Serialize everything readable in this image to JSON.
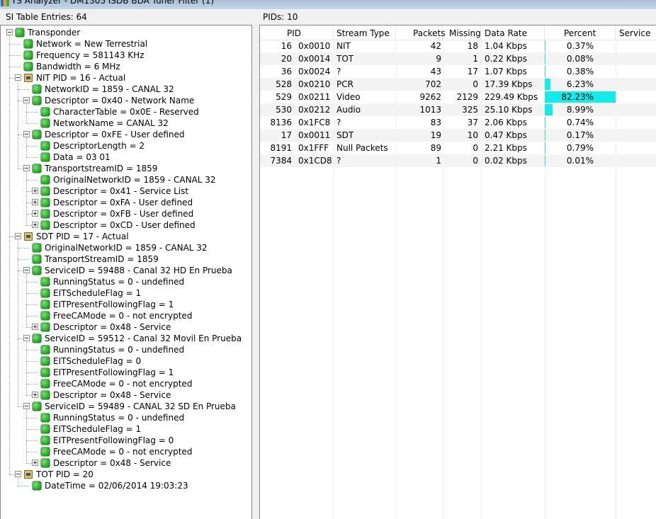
{
  "window": {
    "title": "TS Analyzer - DM1305 ISDB BDA Tuner Filter (1)"
  },
  "left_panel": {
    "header": "SI Table Entries: 64"
  },
  "right_panel": {
    "header": "PIDs: 10"
  },
  "tree": [
    {
      "label": "Transponder",
      "depth": 0,
      "expander": "minus",
      "icon": "green"
    },
    {
      "label": "Network = New Terrestrial",
      "depth": 1,
      "expander": "",
      "icon": "green"
    },
    {
      "label": "Frequency = 581143 KHz",
      "depth": 1,
      "expander": "",
      "icon": "green"
    },
    {
      "label": "Bandwidth = 6 MHz",
      "depth": 1,
      "expander": "",
      "icon": "green"
    },
    {
      "label": "NIT PID = 16 - Actual",
      "depth": 1,
      "expander": "minus",
      "icon": "table"
    },
    {
      "label": "NetworkID = 1859 - CANAL 32",
      "depth": 2,
      "expander": "",
      "icon": "green"
    },
    {
      "label": "Descriptor = 0x40 - Network Name",
      "depth": 2,
      "expander": "minus",
      "icon": "green"
    },
    {
      "label": "CharacterTable = 0x0E - Reserved",
      "depth": 3,
      "expander": "",
      "icon": "green"
    },
    {
      "label": "NetworkName = CANAL 32",
      "depth": 3,
      "expander": "",
      "icon": "green"
    },
    {
      "label": "Descriptor = 0xFE - User defined",
      "depth": 2,
      "expander": "minus",
      "icon": "green"
    },
    {
      "label": "DescriptorLength = 2",
      "depth": 3,
      "expander": "",
      "icon": "green"
    },
    {
      "label": "Data = 03 01",
      "depth": 3,
      "expander": "",
      "icon": "green"
    },
    {
      "label": "TransportstreamID = 1859",
      "depth": 2,
      "expander": "minus",
      "icon": "green"
    },
    {
      "label": "OriginalNetworkID = 1859 - CANAL 32",
      "depth": 3,
      "expander": "",
      "icon": "green"
    },
    {
      "label": "Descriptor = 0x41 - Service List",
      "depth": 3,
      "expander": "plus",
      "icon": "green"
    },
    {
      "label": "Descriptor = 0xFA - User defined",
      "depth": 3,
      "expander": "plus",
      "icon": "green"
    },
    {
      "label": "Descriptor = 0xFB - User defined",
      "depth": 3,
      "expander": "plus",
      "icon": "green"
    },
    {
      "label": "Descriptor = 0xCD - User defined",
      "depth": 3,
      "expander": "plus",
      "icon": "green"
    },
    {
      "label": "SDT PID = 17 - Actual",
      "depth": 1,
      "expander": "minus",
      "icon": "table"
    },
    {
      "label": "OriginalNetworkID = 1859 - CANAL 32",
      "depth": 2,
      "expander": "",
      "icon": "green"
    },
    {
      "label": "TransportStreamID = 1859",
      "depth": 2,
      "expander": "",
      "icon": "green"
    },
    {
      "label": "ServiceID = 59488 - Canal 32 HD En Prueba",
      "depth": 2,
      "expander": "minus",
      "icon": "green"
    },
    {
      "label": "RunningStatus = 0 - undefined",
      "depth": 3,
      "expander": "",
      "icon": "green"
    },
    {
      "label": "EITScheduleFlag = 1",
      "depth": 3,
      "expander": "",
      "icon": "green"
    },
    {
      "label": "EITPresentFollowingFlag = 1",
      "depth": 3,
      "expander": "",
      "icon": "green"
    },
    {
      "label": "FreeCAMode = 0 - not encrypted",
      "depth": 3,
      "expander": "",
      "icon": "green"
    },
    {
      "label": "Descriptor = 0x48 - Service",
      "depth": 3,
      "expander": "plus",
      "icon": "green"
    },
    {
      "label": "ServiceID = 59512 - Canal 32 Movil En Prueba",
      "depth": 2,
      "expander": "minus",
      "icon": "green"
    },
    {
      "label": "RunningStatus = 0 - undefined",
      "depth": 3,
      "expander": "",
      "icon": "green"
    },
    {
      "label": "EITScheduleFlag = 0",
      "depth": 3,
      "expander": "",
      "icon": "green"
    },
    {
      "label": "EITPresentFollowingFlag = 1",
      "depth": 3,
      "expander": "",
      "icon": "green"
    },
    {
      "label": "FreeCAMode = 0 - not encrypted",
      "depth": 3,
      "expander": "",
      "icon": "green"
    },
    {
      "label": "Descriptor = 0x48 - Service",
      "depth": 3,
      "expander": "plus",
      "icon": "green"
    },
    {
      "label": "ServiceID = 59489 - CANAL 32 SD  En Prueba",
      "depth": 2,
      "expander": "minus",
      "icon": "green"
    },
    {
      "label": "RunningStatus = 0 - undefined",
      "depth": 3,
      "expander": "",
      "icon": "green"
    },
    {
      "label": "EITScheduleFlag = 1",
      "depth": 3,
      "expander": "",
      "icon": "green"
    },
    {
      "label": "EITPresentFollowingFlag = 0",
      "depth": 3,
      "expander": "",
      "icon": "green"
    },
    {
      "label": "FreeCAMode = 0 - not encrypted",
      "depth": 3,
      "expander": "",
      "icon": "green"
    },
    {
      "label": "Descriptor = 0x48 - Service",
      "depth": 3,
      "expander": "plus",
      "icon": "green"
    },
    {
      "label": "TOT PID = 20",
      "depth": 1,
      "expander": "minus",
      "icon": "table"
    },
    {
      "label": "DateTime = 02/06/2014 19:03:23",
      "depth": 2,
      "expander": "",
      "icon": "green"
    }
  ],
  "pid_table": {
    "columns": [
      "PID",
      "Stream Type",
      "Packets",
      "Missing",
      "Data Rate",
      "Percent",
      "Service"
    ],
    "rows": [
      {
        "pid_dec": "16",
        "pid_hex": "0x0010",
        "stream_type": "NIT",
        "packets": "42",
        "missing": "18",
        "data_rate": "1.04 Kbps",
        "percent": "0.37%",
        "percent_value": 0.37,
        "service": ""
      },
      {
        "pid_dec": "20",
        "pid_hex": "0x0014",
        "stream_type": "TOT",
        "packets": "9",
        "missing": "1",
        "data_rate": "0.22 Kbps",
        "percent": "0.08%",
        "percent_value": 0.08,
        "service": ""
      },
      {
        "pid_dec": "36",
        "pid_hex": "0x0024",
        "stream_type": "?",
        "packets": "43",
        "missing": "17",
        "data_rate": "1.07 Kbps",
        "percent": "0.38%",
        "percent_value": 0.38,
        "service": ""
      },
      {
        "pid_dec": "528",
        "pid_hex": "0x0210",
        "stream_type": "PCR",
        "packets": "702",
        "missing": "0",
        "data_rate": "17.39 Kbps",
        "percent": "6.23%",
        "percent_value": 6.23,
        "service": ""
      },
      {
        "pid_dec": "529",
        "pid_hex": "0x0211",
        "stream_type": "Video",
        "packets": "9262",
        "missing": "2129",
        "data_rate": "229.49 Kbps",
        "percent": "82.23%",
        "percent_value": 82.23,
        "service": ""
      },
      {
        "pid_dec": "530",
        "pid_hex": "0x0212",
        "stream_type": "Audio",
        "packets": "1013",
        "missing": "325",
        "data_rate": "25.10 Kbps",
        "percent": "8.99%",
        "percent_value": 8.99,
        "service": ""
      },
      {
        "pid_dec": "8136",
        "pid_hex": "0x1FC8",
        "stream_type": "?",
        "packets": "83",
        "missing": "37",
        "data_rate": "2.06 Kbps",
        "percent": "0.74%",
        "percent_value": 0.74,
        "service": ""
      },
      {
        "pid_dec": "17",
        "pid_hex": "0x0011",
        "stream_type": "SDT",
        "packets": "19",
        "missing": "10",
        "data_rate": "0.47 Kbps",
        "percent": "0.17%",
        "percent_value": 0.17,
        "service": ""
      },
      {
        "pid_dec": "8191",
        "pid_hex": "0x1FFF",
        "stream_type": "Null Packets",
        "packets": "89",
        "missing": "0",
        "data_rate": "2.21 Kbps",
        "percent": "0.79%",
        "percent_value": 0.79,
        "service": ""
      },
      {
        "pid_dec": "7384",
        "pid_hex": "0x1CD8",
        "stream_type": "?",
        "packets": "1",
        "missing": "0",
        "data_rate": "0.02 Kbps",
        "percent": "0.01%",
        "percent_value": 0.01,
        "service": ""
      }
    ]
  },
  "colors": {
    "percent_bar": "#14ecec",
    "node_green": "#21a121",
    "alt_row": "#f3f3f3"
  },
  "icons": {
    "tree_node": "green-status-icon",
    "table_node": "table-icon"
  }
}
